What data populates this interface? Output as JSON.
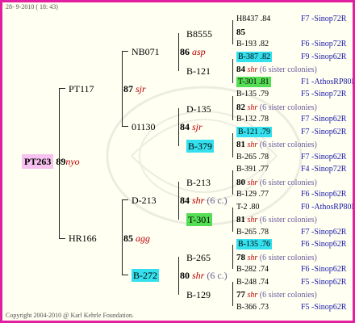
{
  "header": {
    "timestamp": "28- 9-2010 ( 18: 43)"
  },
  "footer": {
    "copyright": "Copyright 2004-2010 @ Karl Kehrle Foundation."
  },
  "root": {
    "id": "PT263",
    "num": "89",
    "mark": "nyo"
  },
  "gen1": {
    "top": {
      "id": "PT117",
      "num": "87",
      "mark": "sjr"
    },
    "bottom": {
      "id": "HR166",
      "num": "85",
      "mark": "agg"
    }
  },
  "gen2": {
    "a": {
      "id": "NB071",
      "num": "86",
      "mark": "asp"
    },
    "b": {
      "id": "01130",
      "num": "84",
      "mark": "sjr"
    },
    "c": {
      "id": "D-213",
      "num": "84",
      "mark": "shr",
      "note": "(6 c.)"
    },
    "d": {
      "id": "B-272",
      "num": "80",
      "mark": "shr",
      "note": "(6 c.)"
    }
  },
  "gen3": {
    "a1": "B8555",
    "a2": "B-121",
    "b1": "D-135",
    "b2": "B-379",
    "c1": "B-213",
    "c2": "T-301",
    "d1": "B-265",
    "d2": "B-129"
  },
  "gen4": [
    {
      "id": "H8437",
      "val": ".84",
      "src": "F7 -Sinop72R"
    },
    {
      "num": "85"
    },
    {
      "id": "B-193",
      "val": ".82",
      "src": "F6 -Sinop72R"
    },
    {
      "id": "B-387",
      "val": ".82",
      "src": "F9 -Sinop62R"
    },
    {
      "num": "84",
      "mark": "shr",
      "note": "(6 sister colonies)"
    },
    {
      "id": "T-301",
      "val": ".81",
      "src": "F1 -AthosRP80R"
    },
    {
      "id": "B-135",
      "val": ".79",
      "src": "F5 -Sinop72R"
    },
    {
      "num": "82",
      "mark": "shr",
      "note": "(6 sister colonies)"
    },
    {
      "id": "B-132",
      "val": ".78",
      "src": "F7 -Sinop62R"
    },
    {
      "id": "B-121",
      "val": ".79",
      "src": "F7 -Sinop62R"
    },
    {
      "num": "81",
      "mark": "shr",
      "note": "(6 sister colonies)"
    },
    {
      "id": "B-265",
      "val": ".78",
      "src": "F7 -Sinop62R"
    },
    {
      "id": "B-391",
      "val": ".77",
      "src": "F4 -Sinop72R"
    },
    {
      "num": "80",
      "mark": "shr",
      "note": "(6 sister colonies)"
    },
    {
      "id": "B-129",
      "val": ".77",
      "src": "F6 -Sinop62R"
    },
    {
      "id": "T-2",
      "val": ".80",
      "src": "F0 -AthosRP80R"
    },
    {
      "num": "81",
      "mark": "shr",
      "note": "(6 sister colonies)"
    },
    {
      "id": "B-265",
      "val": ".78",
      "src": "F7 -Sinop62R"
    },
    {
      "id": "B-135",
      "val": ".76",
      "src": "F6 -Sinop62R"
    },
    {
      "num": "78",
      "mark": "shr",
      "note": "(6 sister colonies)"
    },
    {
      "id": "B-282",
      "val": ".74",
      "src": "F6 -Sinop62R"
    },
    {
      "id": "B-248",
      "val": ".74",
      "src": "F5 -Sinop62R"
    },
    {
      "num": "77",
      "mark": "shr",
      "note": "(6 sister colonies)"
    },
    {
      "id": "B-366",
      "val": ".73",
      "src": "F5 -Sinop62R"
    }
  ],
  "colors": {
    "frame": "#e21fa0",
    "cyan": "#35e0ee",
    "green": "#55dd55",
    "pink": "#f7c2f0",
    "red": "#c00000",
    "blue": "#1a1aa8"
  }
}
